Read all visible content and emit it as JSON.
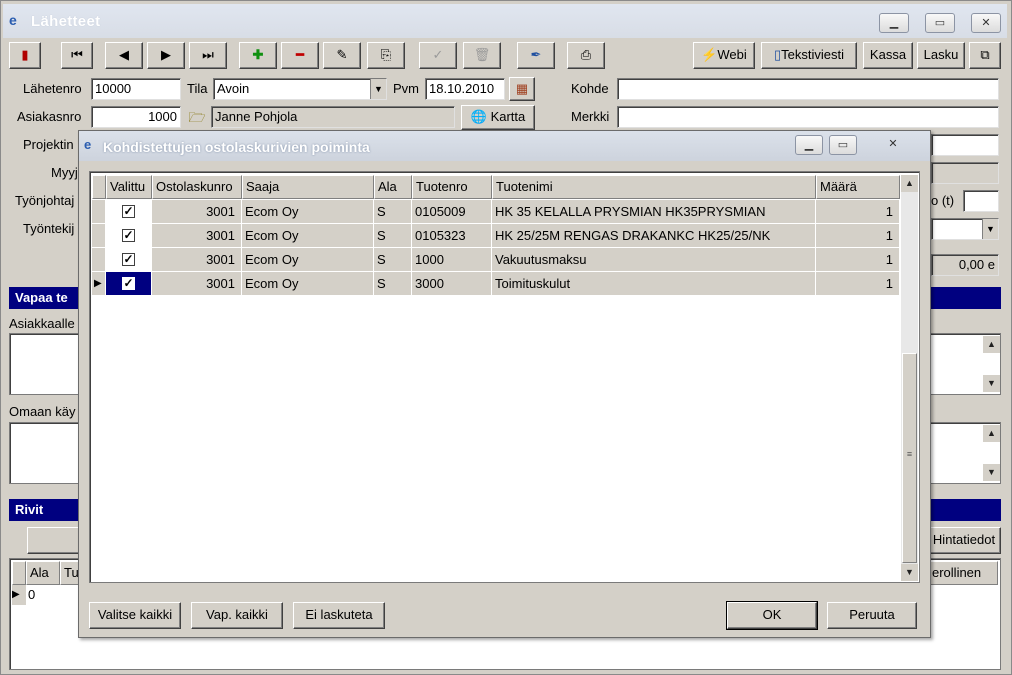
{
  "window": {
    "title": "Lähetteet"
  },
  "toolbar": {
    "webi": "Webi",
    "tekstiviesti": "Tekstiviesti",
    "kassa": "Kassa",
    "lasku": "Lasku"
  },
  "form": {
    "lahetenro_label": "Lähetenro",
    "lahetenro": "10000",
    "tila_label": "Tila",
    "tila": "Avoin",
    "pvm_label": "Pvm",
    "pvm": "18.10.2010",
    "kohde_label": "Kohde",
    "asiakasnro_label": "Asiakasnro",
    "asiakasnro": "1000",
    "asiakas_nimi": "Janne Pohjola",
    "kartta": "Kartta",
    "merkki_label": "Merkki",
    "projektinro_label": "Projektin",
    "myyja_label": "Myyj",
    "tyonjohtaja_label": "Työnjohtaj",
    "tyontekija_label": "Työntekij",
    "alv_label": "o (t)",
    "summa": "0,00 e"
  },
  "sections": {
    "vapaa": "Vapaa te",
    "asiakkaalle": "Asiakkaalle",
    "omaan": "Omaan käy",
    "rivit": "Rivit"
  },
  "rivit": {
    "hintatiedot": "Hintatiedot",
    "col_ala": "Ala",
    "col_tu": "Tu",
    "col_verollinen": "erollinen",
    "row_value": "0"
  },
  "dialog": {
    "title": "Kohdistettujen ostolaskurivien poiminta",
    "columns": [
      "Valittu",
      "Ostolaskunro",
      "Saaja",
      "Ala",
      "Tuotenro",
      "Tuotenimi",
      "Määrä"
    ],
    "rows": [
      {
        "ostolaskunro": "3001",
        "saaja": "Ecom Oy",
        "ala": "S",
        "tuotenro": "0105009",
        "tuotenimi": "HK 35 KELALLA PRYSMIAN HK35PRYSMIAN",
        "maara": "1"
      },
      {
        "ostolaskunro": "3001",
        "saaja": "Ecom Oy",
        "ala": "S",
        "tuotenro": "0105323",
        "tuotenimi": "HK 25/25M RENGAS DRAKANKC HK25/25/NK",
        "maara": "1"
      },
      {
        "ostolaskunro": "3001",
        "saaja": "Ecom Oy",
        "ala": "S",
        "tuotenro": "1000",
        "tuotenimi": "Vakuutusmaksu",
        "maara": "1"
      },
      {
        "ostolaskunro": "3001",
        "saaja": "Ecom Oy",
        "ala": "S",
        "tuotenro": "3000",
        "tuotenimi": "Toimituskulut",
        "maara": "1"
      }
    ],
    "buttons": {
      "valitse": "Valitse kaikki",
      "vap": "Vap. kaikki",
      "ei": "Ei laskuteta",
      "ok": "OK",
      "peruuta": "Peruuta"
    }
  }
}
